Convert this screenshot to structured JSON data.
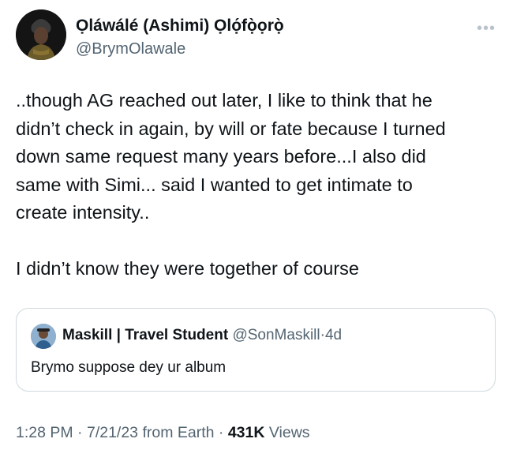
{
  "author": {
    "name": "Ọláwálé (Ashimi) Ọlọ́fọ̀ọrọ̀",
    "handle": "@BrymOlawale",
    "avatar_icon": "profile-photo-icon"
  },
  "more_icon": "more-options-icon",
  "tweet": {
    "paragraph1": "..though AG reached out later, I like to think that he\ndidn’t check in again, by will or fate because I turned\ndown same request many years before...I also did\nsame with Simi... said I wanted to get intimate to\ncreate intensity..",
    "paragraph2": "I didn’t know they were together of course"
  },
  "quoted_tweet": {
    "name": "Maskill | Travel Student",
    "handle": "@SonMaskill",
    "separator": "·",
    "time": "4d",
    "text": "Brymo suppose dey ur album"
  },
  "meta": {
    "time": "1:28 PM",
    "sep1": "·",
    "date": "7/21/23",
    "source": "from Earth",
    "sep2": "·",
    "views_count": "431K",
    "views_label": "Views"
  },
  "colors": {
    "text_primary": "#0f1419",
    "text_secondary": "#536471",
    "border": "#cfd9de"
  }
}
